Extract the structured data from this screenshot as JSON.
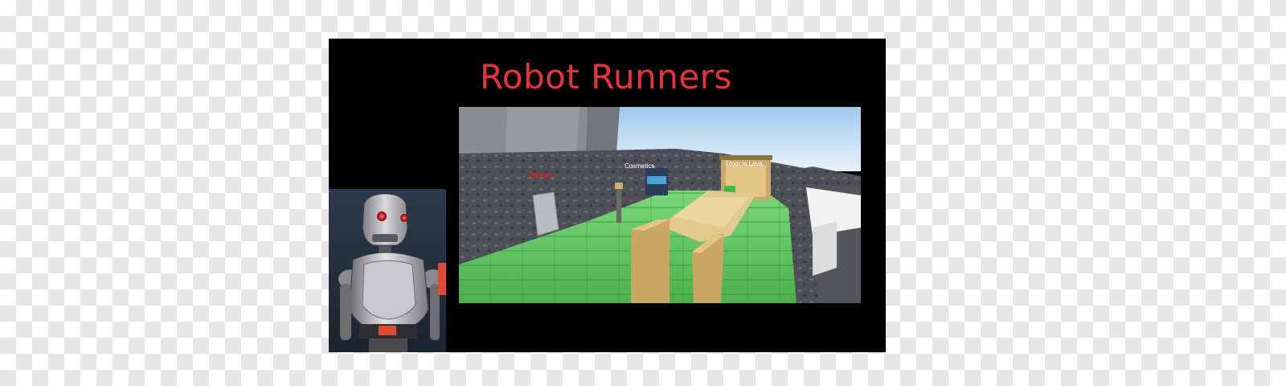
{
  "title": {
    "text": "Robot Runners",
    "color": "#e8323c"
  },
  "portrait": {
    "icon": "robot-character",
    "eye_color": "#e0202a",
    "accent_color": "#e04a30"
  },
  "game_view": {
    "signs": {
      "home": "Home",
      "cosmetics": "Cosmetics",
      "floor_is_lava": "Floor is Lava"
    },
    "colors": {
      "floor": "#5cc45c",
      "path": "#e8c98a",
      "wall": "#4d4d55",
      "sky": "#d9ecf7"
    }
  },
  "background": {
    "card_color": "#000000"
  }
}
